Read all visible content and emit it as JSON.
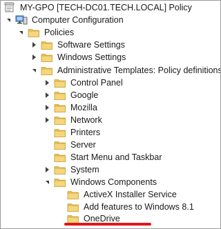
{
  "tree": {
    "root": {
      "label": "MY-GPO [TECH-DC01.TECH.LOCAL] Policy",
      "icon": "gpo-scroll-icon"
    },
    "computer_configuration": {
      "label": "Computer Configuration",
      "icon": "computer-icon"
    },
    "policies": {
      "label": "Policies",
      "icon": "folder-icon"
    },
    "software_settings": {
      "label": "Software Settings",
      "icon": "folder-icon"
    },
    "windows_settings": {
      "label": "Windows Settings",
      "icon": "folder-icon"
    },
    "admin_templates": {
      "label": "Administrative Templates: Policy definitions",
      "icon": "folder-icon"
    },
    "control_panel": {
      "label": "Control Panel",
      "icon": "folder-icon"
    },
    "google": {
      "label": "Google",
      "icon": "folder-icon"
    },
    "mozilla": {
      "label": "Mozilla",
      "icon": "folder-icon"
    },
    "network": {
      "label": "Network",
      "icon": "folder-icon"
    },
    "printers": {
      "label": "Printers",
      "icon": "folder-icon"
    },
    "server": {
      "label": "Server",
      "icon": "folder-icon"
    },
    "start_menu": {
      "label": "Start Menu and Taskbar",
      "icon": "folder-icon"
    },
    "system": {
      "label": "System",
      "icon": "folder-icon"
    },
    "windows_components": {
      "label": "Windows Components",
      "icon": "folder-icon"
    },
    "activex": {
      "label": "ActiveX Installer Service",
      "icon": "folder-icon"
    },
    "add_features": {
      "label": "Add features to Windows 8.1",
      "icon": "folder-icon"
    },
    "onedrive": {
      "label": "OneDrive",
      "icon": "folder-icon",
      "selected": true,
      "highlight_color": "#e3141b"
    }
  },
  "colors": {
    "folder": "#f1cf6b",
    "folder_dark": "#d4a93a",
    "annotation": "#e3141b"
  }
}
